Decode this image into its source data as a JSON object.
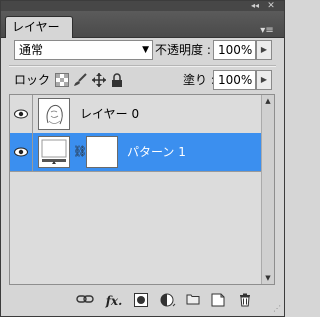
{
  "panel": {
    "tab_label": "レイヤー",
    "collapse_glyph": "◂◂",
    "close_glyph": "✕",
    "menu_glyph": "▾≡"
  },
  "blend": {
    "mode": "通常",
    "opacity_label": "不透明度 :",
    "opacity_value": "100%"
  },
  "lock": {
    "label": "ロック :",
    "fill_label": "塗り :",
    "fill_value": "100%"
  },
  "layers": [
    {
      "name": "レイヤー 0",
      "visible": true,
      "selected": false,
      "icon": "sketch-thumbnail"
    },
    {
      "name": "パターン 1",
      "visible": true,
      "selected": true,
      "icon": "fill-layer-thumbnail"
    }
  ],
  "footer_icons": [
    "link-layers-icon",
    "layer-style-fx-icon",
    "layer-mask-icon",
    "adjustment-layer-icon",
    "new-group-icon",
    "new-layer-icon",
    "trash-icon"
  ],
  "colors": {
    "selection": "#3b8fef",
    "panel": "#d6d6d6",
    "titlebar": "#474747"
  }
}
